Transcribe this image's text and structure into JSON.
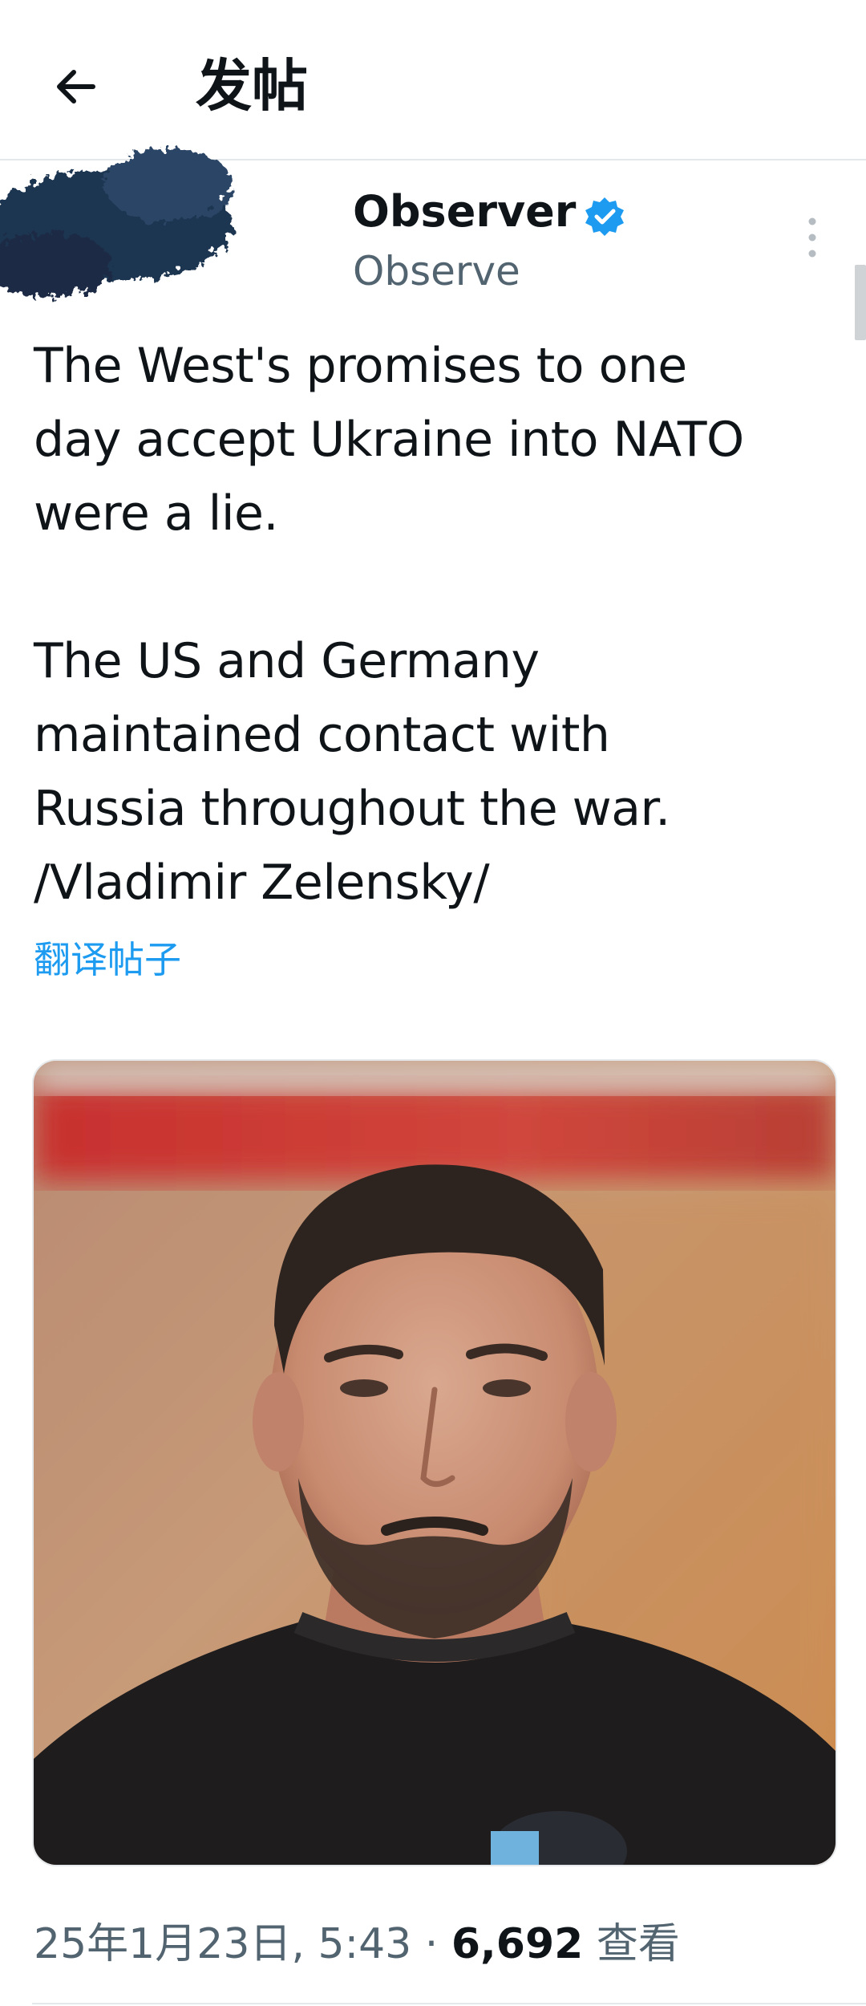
{
  "header": {
    "back_icon": "arrow-left-icon",
    "title": "发帖"
  },
  "author": {
    "display_name_faded": "",
    "display_name": "Observer",
    "handle_faded": "",
    "handle": "Observe",
    "verified_icon": "verified-badge-icon",
    "verified_color": "#1d9bf0",
    "more_icon": "more-vertical-icon"
  },
  "post": {
    "paragraph_1": "The West's promises to one\nday accept Ukraine into NATO\nwere a lie.",
    "paragraph_2": "The US and Germany\nmaintained contact with\nRussia throughout the war.\n/Vladimir Zelensky/",
    "translate_label": "翻译帖子"
  },
  "media": {
    "image_icon": "portrait-photo"
  },
  "meta": {
    "timestamp": "25年1月23日, 5:43",
    "separator": "·",
    "views_count": "6,692",
    "views_label": "查看"
  },
  "colors": {
    "accent": "#1d9bf0",
    "text_primary": "#0f1419",
    "text_secondary": "#536471"
  }
}
